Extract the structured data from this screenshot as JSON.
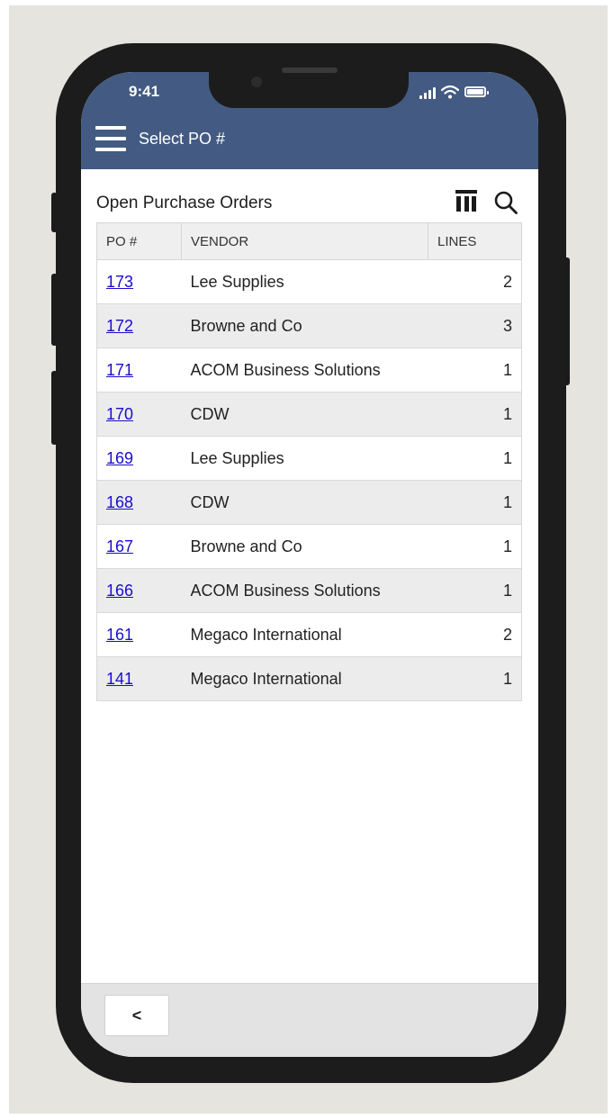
{
  "status_bar": {
    "time": "9:41",
    "icons": [
      "signal-icon",
      "wifi-icon",
      "battery-icon"
    ]
  },
  "header": {
    "menu_icon": "hamburger-menu-icon",
    "title": "Select PO #",
    "color": "#435b82"
  },
  "section": {
    "title": "Open Purchase Orders",
    "actions": [
      "columns-icon",
      "search-icon"
    ]
  },
  "table": {
    "headers": {
      "po": "PO #",
      "vendor": "VENDOR",
      "lines": "LINES"
    },
    "rows": [
      {
        "po": "173",
        "vendor": "Lee Supplies",
        "lines": "2"
      },
      {
        "po": "172",
        "vendor": "Browne and Co",
        "lines": "3"
      },
      {
        "po": "171",
        "vendor": "ACOM Business Solutions",
        "lines": "1"
      },
      {
        "po": "170",
        "vendor": "CDW",
        "lines": "1"
      },
      {
        "po": "169",
        "vendor": "Lee Supplies",
        "lines": "1"
      },
      {
        "po": "168",
        "vendor": "CDW",
        "lines": "1"
      },
      {
        "po": "167",
        "vendor": "Browne and Co",
        "lines": "1"
      },
      {
        "po": "166",
        "vendor": "ACOM Business Solutions",
        "lines": "1"
      },
      {
        "po": "161",
        "vendor": "Megaco International",
        "lines": "2"
      },
      {
        "po": "141",
        "vendor": "Megaco International",
        "lines": "1"
      }
    ]
  },
  "footer": {
    "back_label": "<"
  }
}
